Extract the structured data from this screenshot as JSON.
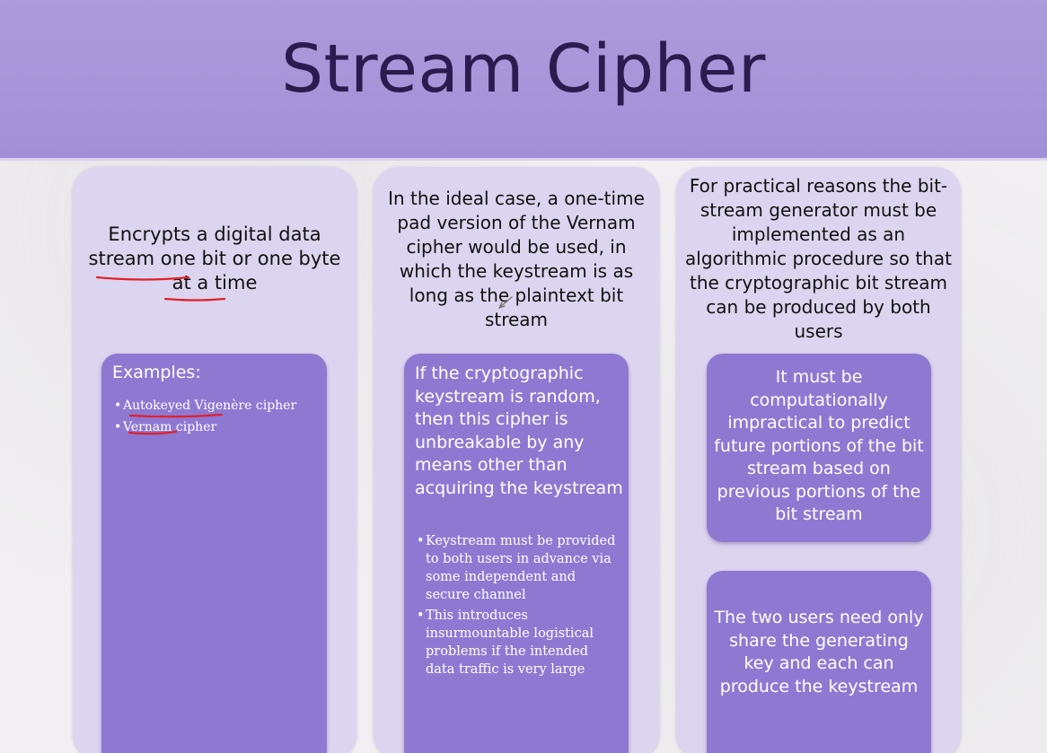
{
  "title": "Stream Cipher",
  "columns": [
    {
      "text": "Encrypts a digital data stream one bit or one byte at a time",
      "box": {
        "heading": "Examples:",
        "bullets": [
          "Autokeyed Vigenère cipher",
          "Vernam cipher"
        ]
      }
    },
    {
      "text": "In the ideal case, a one-time pad version of the Vernam cipher would be used, in which the keystream is as long as the plaintext bit stream",
      "box": {
        "lead": "If the cryptographic keystream is random, then this cipher is unbreakable by any means other than acquiring the keystream",
        "bullets": [
          "Keystream must be provided to both users in advance via some independent and secure channel",
          "This introduces insurmountable logistical problems if the intended data traffic is very large"
        ]
      }
    },
    {
      "text": "For practical reasons the bit-stream generator must be implemented as an algorithmic procedure so that the cryptographic bit stream can be produced by both users",
      "boxes": [
        "It must be computationally impractical to predict future portions of the bit stream based on previous portions of the bit stream",
        "The two users need only share the generating key and each can produce the keystream"
      ]
    }
  ],
  "colors": {
    "header": "#a898d9",
    "title": "#2b1c4f",
    "column": "#dcd5ef",
    "box": "#8e79d2",
    "annotation": "#e0202a"
  }
}
